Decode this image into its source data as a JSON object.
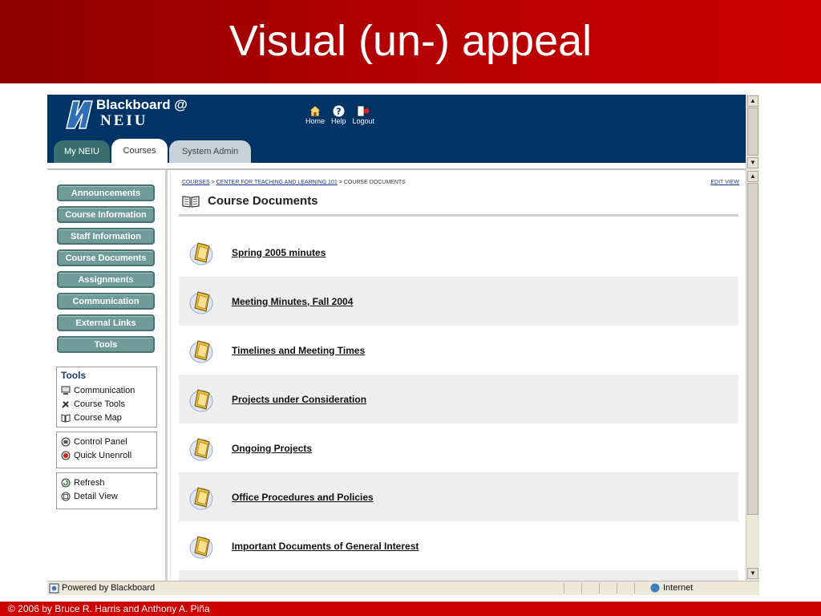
{
  "slide": {
    "title": "Visual (un-) appeal",
    "footer": "© 2006 by Bruce R. Harris and Anthony A. Piña"
  },
  "header": {
    "logo_line1": "Blackboard @",
    "logo_line2": "NEIU",
    "nav": [
      {
        "label": "Home",
        "icon": "home-icon"
      },
      {
        "label": "Help",
        "icon": "help-icon"
      },
      {
        "label": "Logout",
        "icon": "logout-icon"
      }
    ],
    "tabs": [
      {
        "label": "My NEIU"
      },
      {
        "label": "Courses"
      },
      {
        "label": "System Admin"
      }
    ]
  },
  "sidebar": {
    "menu": [
      {
        "label": "Announcements"
      },
      {
        "label": "Course Information"
      },
      {
        "label": "Staff Information"
      },
      {
        "label": "Course Documents"
      },
      {
        "label": "Assignments"
      },
      {
        "label": "Communication"
      },
      {
        "label": "External Links"
      },
      {
        "label": "Tools"
      }
    ],
    "tools_box": {
      "title": "Tools",
      "items": [
        {
          "label": "Communication",
          "icon": "computer-icon"
        },
        {
          "label": "Course Tools",
          "icon": "tools-icon"
        },
        {
          "label": "Course Map",
          "icon": "map-icon"
        }
      ]
    },
    "control_box": {
      "items": [
        {
          "label": "Control Panel",
          "icon": "control-panel-icon"
        },
        {
          "label": "Quick Unenroll",
          "icon": "unenroll-icon"
        }
      ]
    },
    "view_box": {
      "items": [
        {
          "label": "Refresh",
          "icon": "refresh-icon"
        },
        {
          "label": "Detail View",
          "icon": "detail-view-icon"
        }
      ]
    }
  },
  "main": {
    "breadcrumb": {
      "courses": "COURSES",
      "sep": ">",
      "course": "CENTER FOR TEACHING AND LEARNING 101",
      "current": "COURSE DOCUMENTS"
    },
    "edit_view": "EDIT VIEW",
    "title": "Course Documents",
    "documents": [
      {
        "label": "Spring 2005 minutes"
      },
      {
        "label": "Meeting Minutes, Fall 2004"
      },
      {
        "label": "Timelines and Meeting Times"
      },
      {
        "label": "Projects under Consideration"
      },
      {
        "label": "Ongoing Projects"
      },
      {
        "label": "Office Procedures and Policies"
      },
      {
        "label": "Important Documents of General Interest"
      }
    ]
  },
  "status_bar": {
    "text": "Powered by Blackboard",
    "zone": "Internet"
  },
  "colors": {
    "title_bar": "#b00000",
    "banner": "#003366",
    "menu_button": "#6f9b9b"
  }
}
